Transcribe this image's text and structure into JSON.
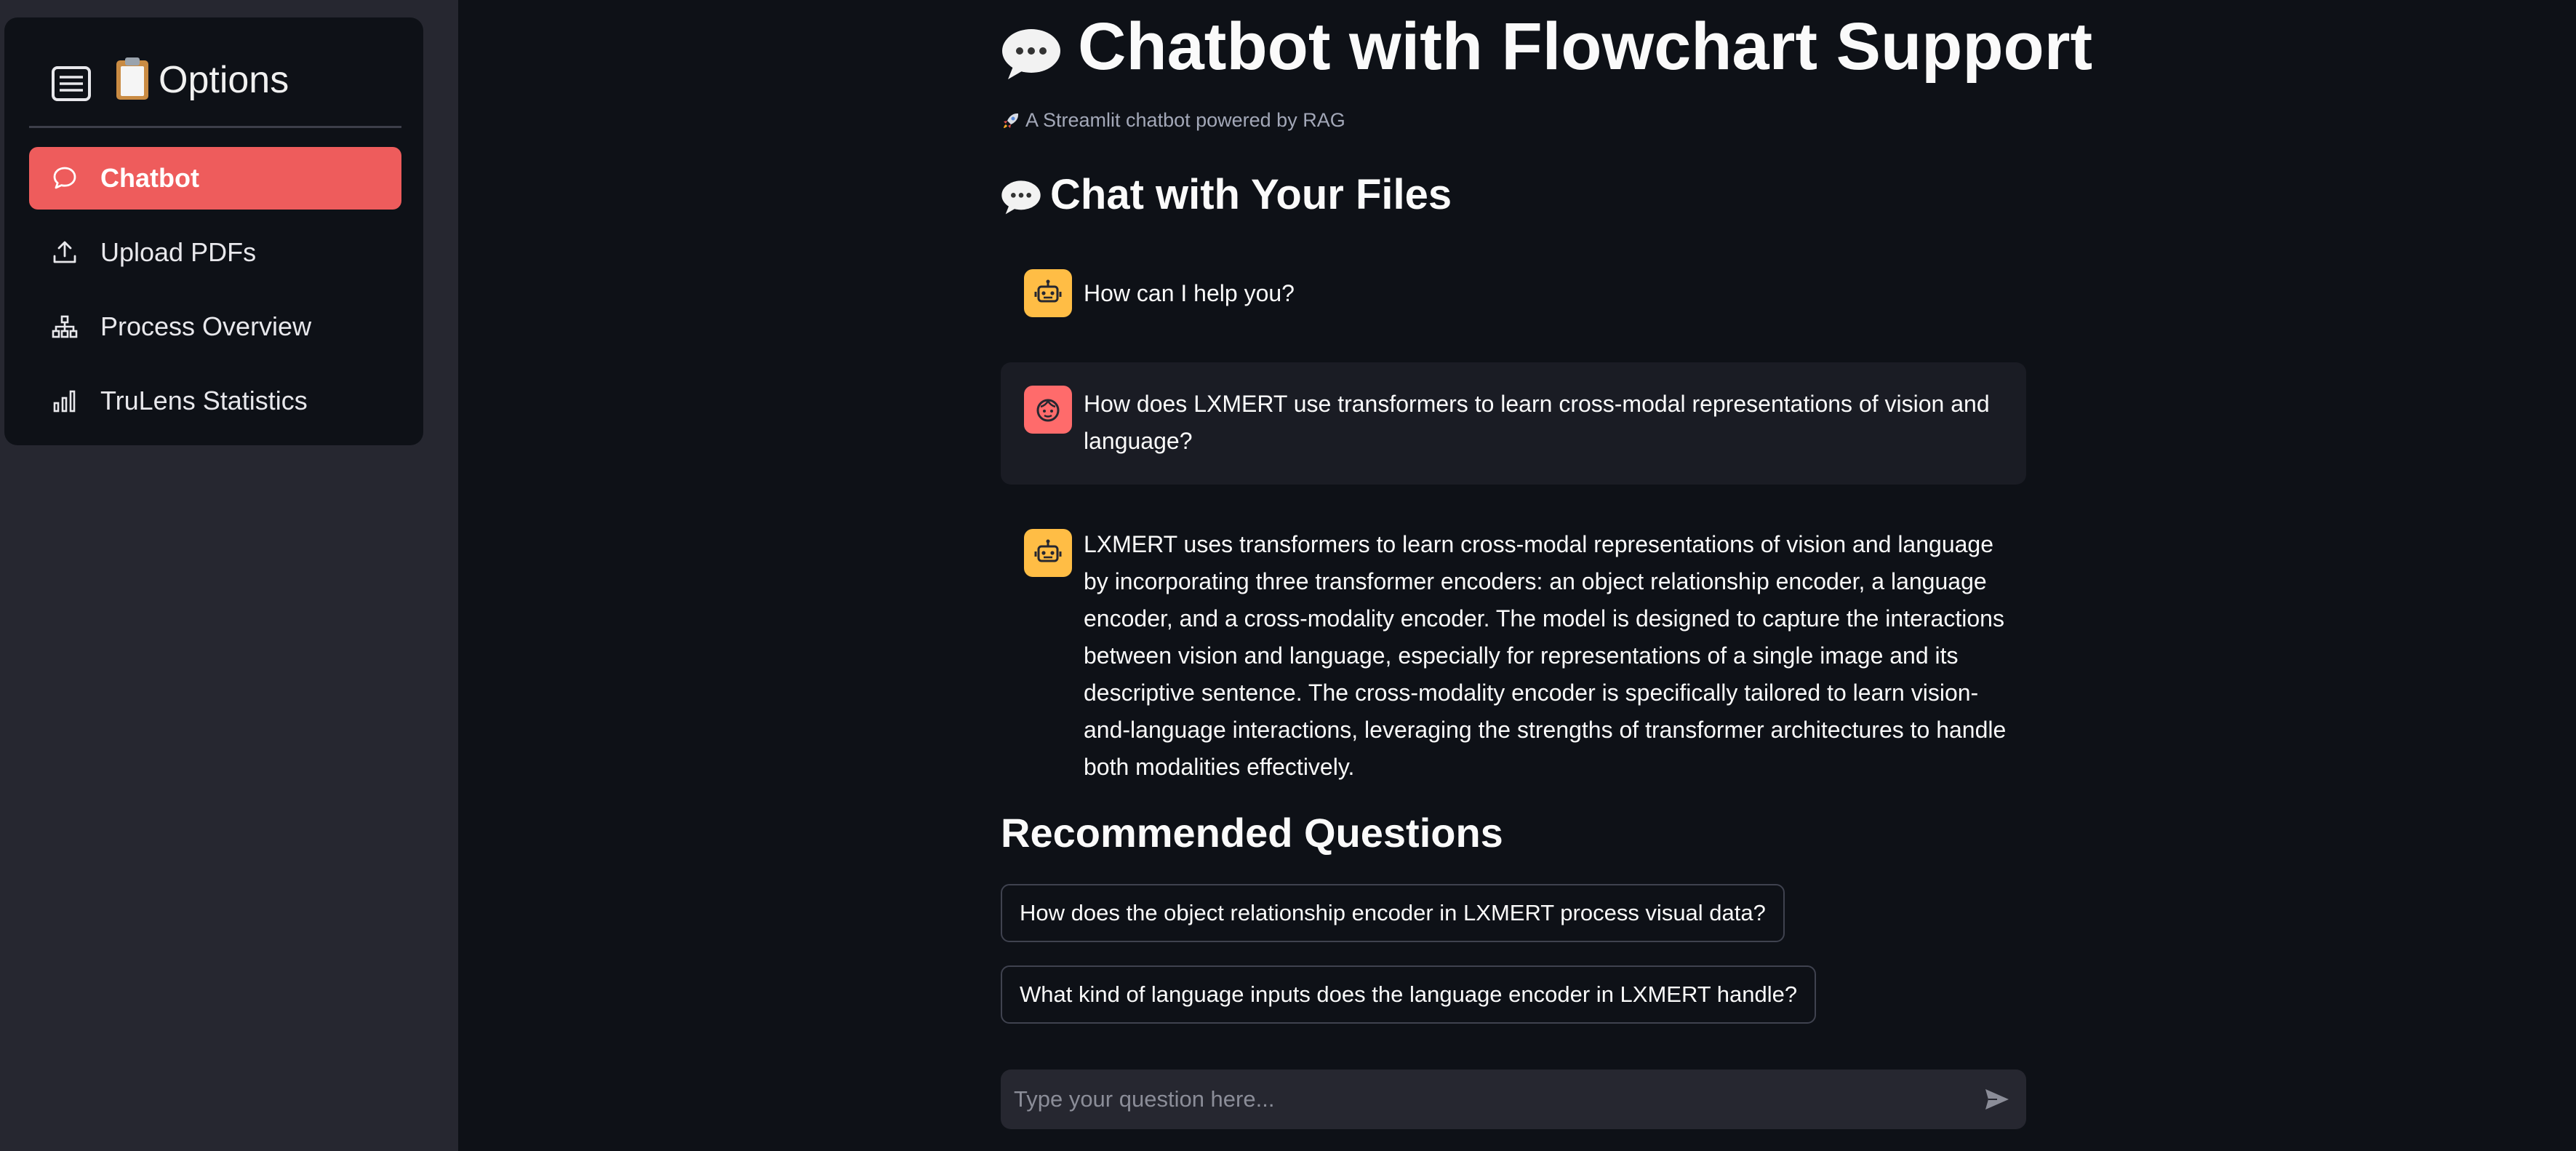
{
  "sidebar": {
    "title": "Options",
    "items": [
      {
        "label": "Chatbot",
        "icon": "chat-bubble-icon",
        "active": true
      },
      {
        "label": "Upload PDFs",
        "icon": "upload-icon",
        "active": false
      },
      {
        "label": "Process Overview",
        "icon": "diagram-icon",
        "active": false
      },
      {
        "label": "TruLens Statistics",
        "icon": "bar-chart-icon",
        "active": false
      }
    ],
    "accent_color": "#ee5c5c"
  },
  "main": {
    "title": "Chatbot with Flowchart Support",
    "subtitle": "A Streamlit chatbot powered by RAG",
    "section_title": "Chat with Your Files",
    "messages": [
      {
        "role": "assistant",
        "text": "How can I help you?"
      },
      {
        "role": "user",
        "text": "How does LXMERT use transformers to learn cross-modal representations of vision and language?"
      },
      {
        "role": "assistant",
        "text": "LXMERT uses transformers to learn cross-modal representations of vision and language by incorporating three transformer encoders: an object relationship encoder, a language encoder, and a cross-modality encoder. The model is designed to capture the interactions between vision and language, especially for representations of a single image and its descriptive sentence. The cross-modality encoder is specifically tailored to learn vision-and-language interactions, leveraging the strengths of transformer architectures to handle both modalities effectively."
      }
    ],
    "recommended_title": "Recommended Questions",
    "recommended_questions": [
      "How does the object relationship encoder in LXMERT process visual data?",
      "What kind of language inputs does the language encoder in LXMERT handle?"
    ],
    "input": {
      "placeholder": "Type your question here...",
      "value": ""
    }
  }
}
